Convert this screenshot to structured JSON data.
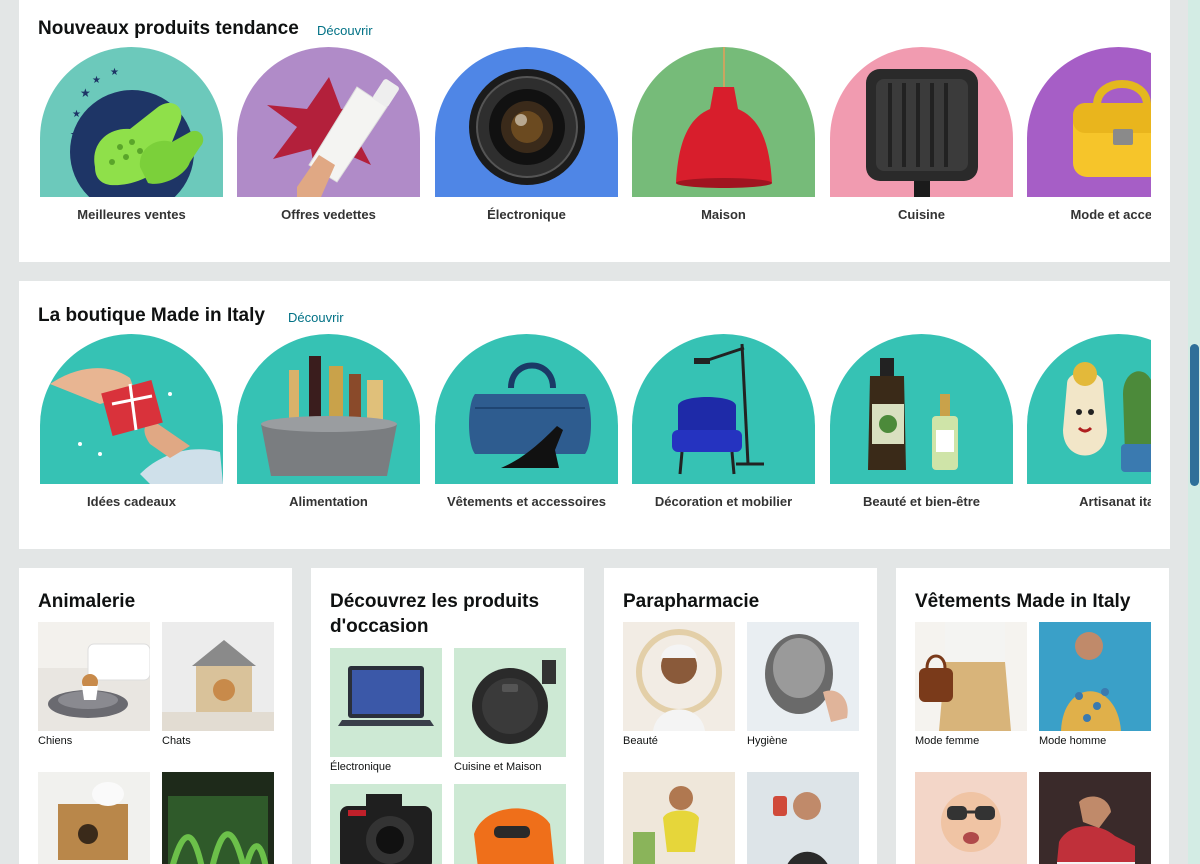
{
  "trending": {
    "title": "Nouveaux produits tendance",
    "discover": "Découvrir",
    "items": [
      {
        "label": "Meilleures ventes",
        "icon": "green-clog-icon",
        "bg": "#6cc9bb"
      },
      {
        "label": "Offres vedettes",
        "icon": "white-bottle-icon",
        "bg": "#b08bc8"
      },
      {
        "label": "Électronique",
        "icon": "camera-lens-icon",
        "bg": "#4f86e6"
      },
      {
        "label": "Maison",
        "icon": "red-lamp-icon",
        "bg": "#76bb79"
      },
      {
        "label": "Cuisine",
        "icon": "grill-pan-icon",
        "bg": "#f19bb0"
      },
      {
        "label": "Mode et access",
        "icon": "yellow-bag-icon",
        "bg": "#a65ec6"
      }
    ]
  },
  "italy": {
    "title": "La boutique Made in Italy",
    "discover": "Découvrir",
    "items": [
      {
        "label": "Idées cadeaux",
        "icon": "gift-hands-icon",
        "bg": "#36c2b4"
      },
      {
        "label": "Alimentation",
        "icon": "food-basket-icon",
        "bg": "#36c2b4"
      },
      {
        "label": "Vêtements et accessoires",
        "icon": "bag-heels-icon",
        "bg": "#36c2b4"
      },
      {
        "label": "Décoration et mobilier",
        "icon": "armchair-lamp-icon",
        "bg": "#36c2b4"
      },
      {
        "label": "Beauté et bien-être",
        "icon": "cosmetics-icon",
        "bg": "#36c2b4"
      },
      {
        "label": "Artisanat ital",
        "icon": "ceramic-vase-icon",
        "bg": "#36c2b4"
      }
    ]
  },
  "cards": [
    {
      "title": "Animalerie",
      "tiles": [
        {
          "label": "Chiens",
          "icon": "dog-bed-icon"
        },
        {
          "label": "Chats",
          "icon": "cat-house-icon"
        },
        {
          "label": "",
          "icon": "hamster-house-icon"
        },
        {
          "label": "",
          "icon": "aquarium-icon"
        }
      ]
    },
    {
      "title": "Découvrez les produits d'occasion",
      "tiles": [
        {
          "label": "Électronique",
          "icon": "laptop-icon"
        },
        {
          "label": "Cuisine et Maison",
          "icon": "robot-vacuum-icon"
        },
        {
          "label": "",
          "icon": "dslr-camera-icon"
        },
        {
          "label": "",
          "icon": "orange-sander-icon"
        }
      ]
    },
    {
      "title": "Parapharmacie",
      "tiles": [
        {
          "label": "Beauté",
          "icon": "skincare-woman-icon"
        },
        {
          "label": "Hygiène",
          "icon": "hair-wash-icon"
        },
        {
          "label": "",
          "icon": "fitness-woman-icon"
        },
        {
          "label": "",
          "icon": "drinking-man-icon"
        }
      ]
    },
    {
      "title": "Vêtements Made in Italy",
      "tiles": [
        {
          "label": "Mode femme",
          "icon": "women-fashion-icon"
        },
        {
          "label": "Mode homme",
          "icon": "men-fashion-icon"
        },
        {
          "label": "",
          "icon": "baby-sunglasses-icon"
        },
        {
          "label": "",
          "icon": "sneakers-icon"
        }
      ]
    }
  ]
}
